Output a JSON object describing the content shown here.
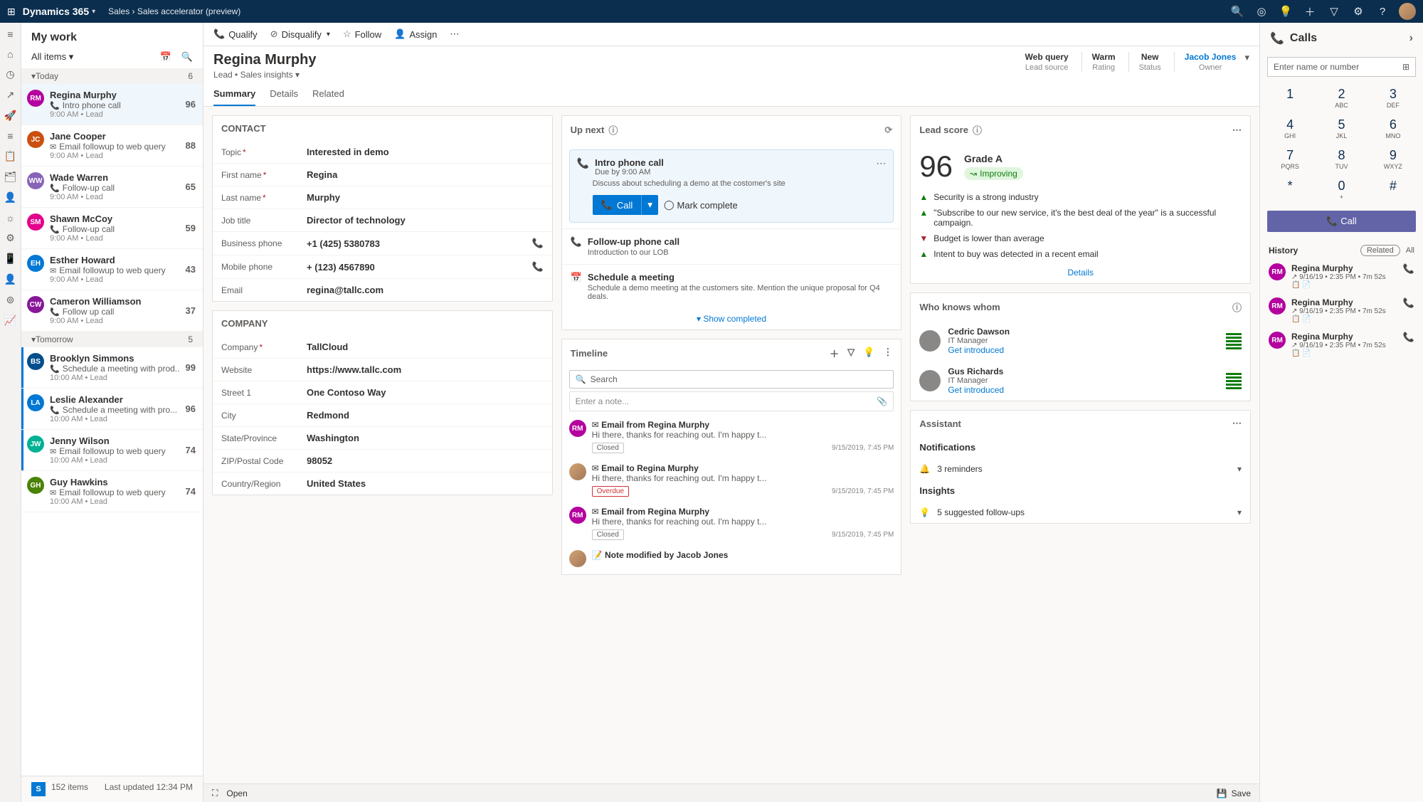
{
  "topbar": {
    "brand": "Dynamics 365",
    "crumb1": "Sales",
    "crumb2": "Sales accelerator (preview)"
  },
  "leftRail": [
    "≡",
    "⌂",
    "◷",
    "↗",
    "🚀",
    "≡",
    "📋",
    "🗂",
    "👤",
    "☼",
    "⚙",
    "📱",
    "👤",
    "⊚",
    "📈"
  ],
  "worklist": {
    "title": "My work",
    "filter": "All items",
    "groups": [
      {
        "label": "Today",
        "count": 6,
        "items": [
          {
            "initials": "RM",
            "color": "#b4009e",
            "name": "Regina Murphy",
            "icon": "📞",
            "line2": "Intro phone call",
            "meta": "9:00 AM • Lead",
            "score": 96,
            "selected": true
          },
          {
            "initials": "JC",
            "color": "#ca5010",
            "name": "Jane Cooper",
            "icon": "✉",
            "line2": "Email followup to web query",
            "meta": "9:00 AM • Lead",
            "score": 88
          },
          {
            "initials": "WW",
            "color": "#8764b8",
            "name": "Wade Warren",
            "icon": "📞",
            "line2": "Follow-up call",
            "meta": "9:00 AM • Lead",
            "score": 65
          },
          {
            "initials": "SM",
            "color": "#e3008c",
            "name": "Shawn McCoy",
            "icon": "📞",
            "line2": "Follow-up call",
            "meta": "9:00 AM • Lead",
            "score": 59
          },
          {
            "initials": "EH",
            "color": "#0078d4",
            "name": "Esther Howard",
            "icon": "✉",
            "line2": "Email followup to web query",
            "meta": "9:00 AM • Lead",
            "score": 43
          },
          {
            "initials": "CW",
            "color": "#881798",
            "name": "Cameron Williamson",
            "icon": "📞",
            "line2": "Follow up call",
            "meta": "9:00 AM • Lead",
            "score": 37
          }
        ]
      },
      {
        "label": "Tomorrow",
        "count": 5,
        "items": [
          {
            "initials": "BS",
            "color": "#004e8c",
            "name": "Brooklyn Simmons",
            "icon": "📞",
            "line2": "Schedule a meeting with prod..",
            "meta": "10:00 AM • Lead",
            "score": 99,
            "accent": true
          },
          {
            "initials": "LA",
            "color": "#0078d4",
            "name": "Leslie Alexander",
            "icon": "📞",
            "line2": "Schedule a meeting with pro...",
            "meta": "10:00 AM • Lead",
            "score": 96,
            "accent": true
          },
          {
            "initials": "JW",
            "color": "#00b294",
            "name": "Jenny Wilson",
            "icon": "✉",
            "line2": "Email followup to web query",
            "meta": "10:00 AM • Lead",
            "score": 74,
            "accent": true
          },
          {
            "initials": "GH",
            "color": "#498205",
            "name": "Guy Hawkins",
            "icon": "✉",
            "line2": "Email followup to web query",
            "meta": "10:00 AM • Lead",
            "score": 74
          }
        ]
      }
    ],
    "footer": {
      "count": "152 items",
      "updated": "Last updated 12:34 PM"
    }
  },
  "commandBar": [
    {
      "icon": "📞",
      "label": "Qualify"
    },
    {
      "icon": "⊘",
      "label": "Disqualify",
      "chevron": true
    },
    {
      "icon": "☆",
      "label": "Follow"
    },
    {
      "icon": "👤",
      "label": "Assign"
    }
  ],
  "record": {
    "title": "Regina Murphy",
    "subtitle": "Lead • Sales insights",
    "headerFields": [
      {
        "value": "Web query",
        "label": "Lead source"
      },
      {
        "value": "Warm",
        "label": "Rating"
      },
      {
        "value": "New",
        "label": "Status"
      },
      {
        "value": "Jacob Jones",
        "label": "Owner",
        "owner": true
      }
    ]
  },
  "tabs": [
    "Summary",
    "Details",
    "Related"
  ],
  "contact": {
    "title": "CONTACT",
    "rows": [
      {
        "label": "Topic",
        "req": true,
        "value": "Interested in demo"
      },
      {
        "label": "First name",
        "req": true,
        "value": "Regina"
      },
      {
        "label": "Last name",
        "req": true,
        "value": "Murphy"
      },
      {
        "label": "Job title",
        "value": "Director of technology"
      },
      {
        "label": "Business phone",
        "value": "+1 (425) 5380783",
        "phone": true
      },
      {
        "label": "Mobile phone",
        "value": "+ (123) 4567890",
        "phone": true
      },
      {
        "label": "Email",
        "value": "regina@tallc.com"
      }
    ]
  },
  "company": {
    "title": "COMPANY",
    "rows": [
      {
        "label": "Company",
        "req": true,
        "value": "TallCloud"
      },
      {
        "label": "Website",
        "value": "https://www.tallc.com"
      },
      {
        "label": "Street 1",
        "value": "One Contoso Way"
      },
      {
        "label": "City",
        "value": "Redmond"
      },
      {
        "label": "State/Province",
        "value": "Washington"
      },
      {
        "label": "ZIP/Postal Code",
        "value": "98052"
      },
      {
        "label": "Country/Region",
        "value": "United States"
      }
    ]
  },
  "upnext": {
    "title": "Up next",
    "active": {
      "title": "Intro phone call",
      "due": "Due by 9:00 AM",
      "desc": "Discuss about scheduling a demo at the costomer's site",
      "callLabel": "Call",
      "doneLabel": "Mark complete"
    },
    "items": [
      {
        "icon": "📞",
        "title": "Follow-up phone call",
        "desc": "Introduction to our LOB"
      },
      {
        "icon": "📅",
        "title": "Schedule a meeting",
        "desc": "Schedule a demo meeting at the customers site. Mention the unique proposal for Q4 deals."
      }
    ],
    "showCompleted": "Show completed"
  },
  "timeline": {
    "title": "Timeline",
    "searchPlaceholder": "Search",
    "notePlaceholder": "Enter a note...",
    "items": [
      {
        "avc": "RM",
        "avcColor": "#b4009e",
        "icon": "✉",
        "title": "Email from Regina Murphy",
        "text": "Hi there, thanks for reaching out. I'm happy t...",
        "tag": "Closed",
        "time": "9/15/2019, 7:45 PM"
      },
      {
        "img": true,
        "icon": "✉",
        "title": "Email to Regina Murphy",
        "text": "Hi there, thanks for reaching out. I'm happy t...",
        "tag": "Overdue",
        "overdue": true,
        "time": "9/15/2019, 7:45 PM"
      },
      {
        "avc": "RM",
        "avcColor": "#b4009e",
        "icon": "✉",
        "title": "Email from Regina Murphy",
        "text": "Hi there, thanks for reaching out. I'm happy t...",
        "tag": "Closed",
        "time": "9/15/2019, 7:45 PM"
      },
      {
        "img": true,
        "icon": "📝",
        "title": "Note modified by Jacob Jones",
        "text": ""
      }
    ]
  },
  "leadscore": {
    "title": "Lead score",
    "score": 96,
    "grade": "Grade A",
    "trend": "Improving",
    "lines": [
      {
        "dir": "up",
        "text": "Security is a strong industry"
      },
      {
        "dir": "up",
        "text": "\"Subscribe to our new service, it's the best deal of the year\" is a successful campaign."
      },
      {
        "dir": "down",
        "text": "Budget is lower than average"
      },
      {
        "dir": "up",
        "text": "Intent to buy was detected in a recent email"
      }
    ],
    "detailsLabel": "Details"
  },
  "whoknows": {
    "title": "Who knows whom",
    "people": [
      {
        "name": "Cedric Dawson",
        "title": "IT Manager",
        "link": "Get introduced"
      },
      {
        "name": "Gus Richards",
        "title": "IT Manager",
        "link": "Get introduced"
      }
    ]
  },
  "assistant": {
    "title": "Assistant",
    "notificationsLabel": "Notifications",
    "reminders": "3 reminders",
    "insightsLabel": "Insights",
    "followups": "5 suggested follow-ups"
  },
  "phone": {
    "title": "Calls",
    "inputPlaceholder": "Enter name or number",
    "keys": [
      {
        "n": "1",
        "s": ""
      },
      {
        "n": "2",
        "s": "ABC"
      },
      {
        "n": "3",
        "s": "DEF"
      },
      {
        "n": "4",
        "s": "GHI"
      },
      {
        "n": "5",
        "s": "JKL"
      },
      {
        "n": "6",
        "s": "MNO"
      },
      {
        "n": "7",
        "s": "PQRS"
      },
      {
        "n": "8",
        "s": "TUV"
      },
      {
        "n": "9",
        "s": "WXYZ"
      },
      {
        "n": "*",
        "s": ""
      },
      {
        "n": "0",
        "s": "+"
      },
      {
        "n": "#",
        "s": ""
      }
    ],
    "callLabel": "Call",
    "historyLabel": "History",
    "relatedLabel": "Related",
    "allLabel": "All",
    "history": [
      {
        "name": "Regina Murphy",
        "meta": "↗ 9/16/19 • 2:35 PM • 7m 52s"
      },
      {
        "name": "Regina Murphy",
        "meta": "↗ 9/16/19 • 2:35 PM • 7m 52s"
      },
      {
        "name": "Regina Murphy",
        "meta": "↗ 9/16/19 • 2:35 PM • 7m 52s"
      }
    ]
  },
  "statusbar": {
    "open": "Open",
    "save": "Save"
  }
}
